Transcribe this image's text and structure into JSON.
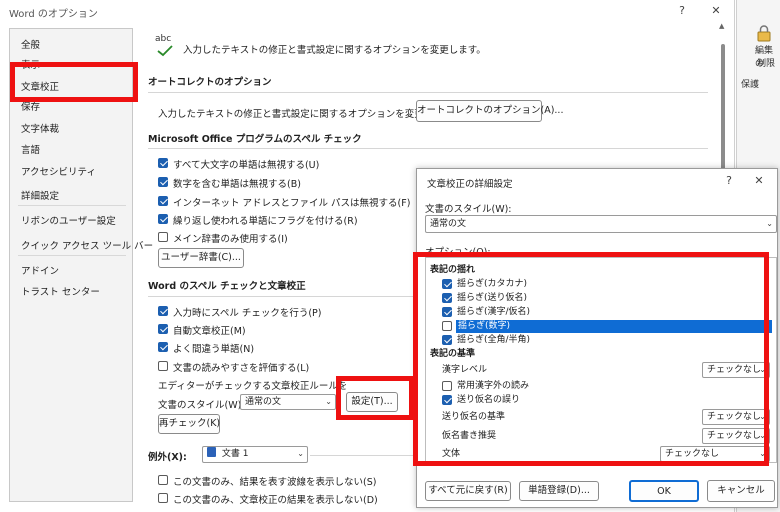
{
  "main": {
    "title": "Word のオプション",
    "help_icon": "?",
    "close_icon": "✕",
    "sidebar": [
      {
        "label": "全般"
      },
      {
        "label": "表示"
      },
      {
        "label": "文章校正"
      },
      {
        "label": "保存"
      },
      {
        "label": "文字体裁"
      },
      {
        "label": "言語"
      },
      {
        "label": "アクセシビリティ"
      },
      {
        "label": "詳細設定"
      },
      {
        "label": "リボンのユーザー設定"
      },
      {
        "label": "クイック アクセス ツール バー"
      },
      {
        "label": "アドイン"
      },
      {
        "label": "トラスト センター"
      }
    ],
    "header_icon_text": "abc",
    "header_text": "入力したテキストの修正と書式設定に関するオプションを変更します。",
    "autocorrect": {
      "heading": "オートコレクトのオプション",
      "desc": "入力したテキストの修正と書式設定に関するオプションを変更します。",
      "button": "オートコレクトのオプション(A)..."
    },
    "office_spell": {
      "heading": "Microsoft Office プログラムのスペル チェック",
      "options": [
        {
          "label": "すべて大文字の単語は無視する(U)",
          "checked": true
        },
        {
          "label": "数字を含む単語は無視する(B)",
          "checked": true
        },
        {
          "label": "インターネット アドレスとファイル パスは無視する(F)",
          "checked": true
        },
        {
          "label": "繰り返し使われる単語にフラグを付ける(R)",
          "checked": true
        },
        {
          "label": "メイン辞書のみ使用する(I)",
          "checked": false
        }
      ],
      "dict_button": "ユーザー辞書(C)..."
    },
    "word_spell": {
      "heading": "Word のスペル チェックと文章校正",
      "options": [
        {
          "label": "入力時にスペル チェックを行う(P)",
          "checked": true
        },
        {
          "label": "自動文章校正(M)",
          "checked": true
        },
        {
          "label": "よく間違う単語(N)",
          "checked": true
        },
        {
          "label": "文書の読みやすさを評価する(L)",
          "checked": false
        }
      ],
      "editor_text": "エディターがチェックする文章校正ルールを選びます",
      "style_label": "文書のスタイル(W):",
      "style_value": "通常の文",
      "settings_button": "設定(T)...",
      "recheck_button": "再チェック(K)"
    },
    "exceptions": {
      "label": "例外(X):",
      "doc_value": "文書 1",
      "options": [
        {
          "label": "この文書のみ、結果を表す波線を表示しない(S)",
          "checked": false
        },
        {
          "label": "この文書のみ、文章校正の結果を表示しない(D)",
          "checked": false
        }
      ]
    }
  },
  "background_app": {
    "label1": "編集の",
    "label2": "制限",
    "label3": "保護"
  },
  "sub": {
    "title": "文章校正の詳細設定",
    "help_icon": "?",
    "close_icon": "✕",
    "style_label": "文書のスタイル(W):",
    "style_value": "通常の文",
    "options_label": "オプション(O):",
    "groups": [
      {
        "heading": "表記の揺れ",
        "items": [
          {
            "label": "揺らぎ(カタカナ)",
            "checked": true,
            "selected": false
          },
          {
            "label": "揺らぎ(送り仮名)",
            "checked": true,
            "selected": false
          },
          {
            "label": "揺らぎ(漢字/仮名)",
            "checked": true,
            "selected": false
          },
          {
            "label": "揺らぎ(数字)",
            "checked": false,
            "selected": true
          },
          {
            "label": "揺らぎ(全角/半角)",
            "checked": true,
            "selected": false
          }
        ]
      },
      {
        "heading": "表記の基準",
        "items": [
          {
            "label": "漢字レベル",
            "value": "チェックなし"
          },
          {
            "label": "常用漢字外の読み",
            "checked": false
          },
          {
            "label": "送り仮名の誤り",
            "checked": true
          },
          {
            "label": "送り仮名の基準",
            "value": "チェックなし"
          },
          {
            "label": "仮名書き推奨",
            "value": "チェックなし"
          },
          {
            "label": "文体",
            "value": "チェックなし"
          }
        ]
      }
    ],
    "reset_button": "すべて元に戻す(R)",
    "word_register_button": "単語登録(D)...",
    "ok_button": "OK",
    "cancel_button": "キャンセル"
  },
  "colors": {
    "accent": "#1c5fb0",
    "selection": "#0f6cd4",
    "highlight": "#ee1111"
  }
}
